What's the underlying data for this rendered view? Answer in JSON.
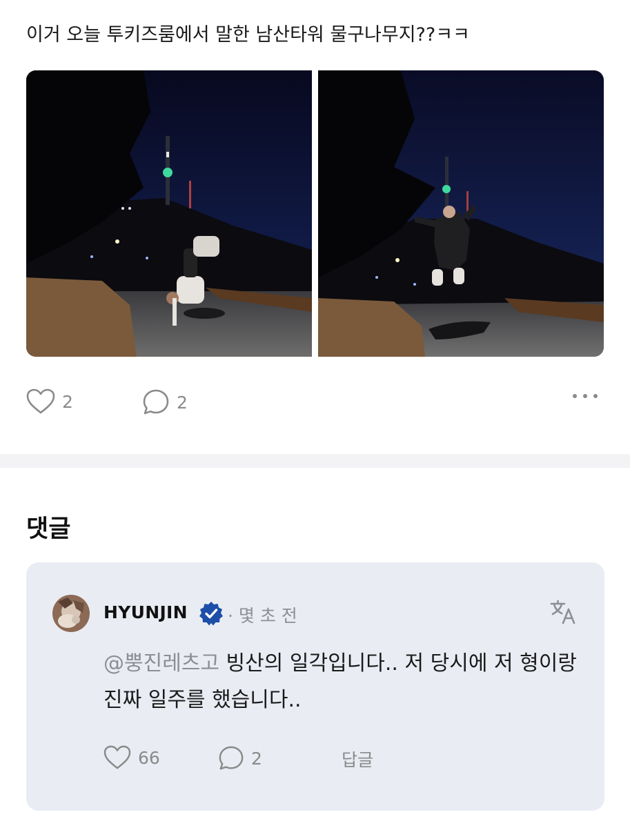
{
  "post": {
    "text": "이거 오늘 투키즈룸에서 말한 남산타워 물구나무지??ㅋㅋ",
    "likes": "2",
    "comments": "2"
  },
  "comments_section": {
    "title": "댓글"
  },
  "comment": {
    "author": "HYUNJIN",
    "time": "· 몇 초 전",
    "mention": "@뿡진레츠고",
    "text": " 빙산의 일각입니다.. 저 당시에 저 형이랑 진짜 일주를 했습니다..",
    "likes": "66",
    "replies": "2",
    "reply_label": "답글"
  },
  "colors": {
    "badge": "#1d4fa8",
    "card_bg": "#e9ecf3",
    "muted": "#8a8a8a"
  },
  "icons": [
    "heart-icon",
    "comment-bubble-icon",
    "more-dots-icon",
    "verified-badge-icon",
    "translate-icon"
  ]
}
